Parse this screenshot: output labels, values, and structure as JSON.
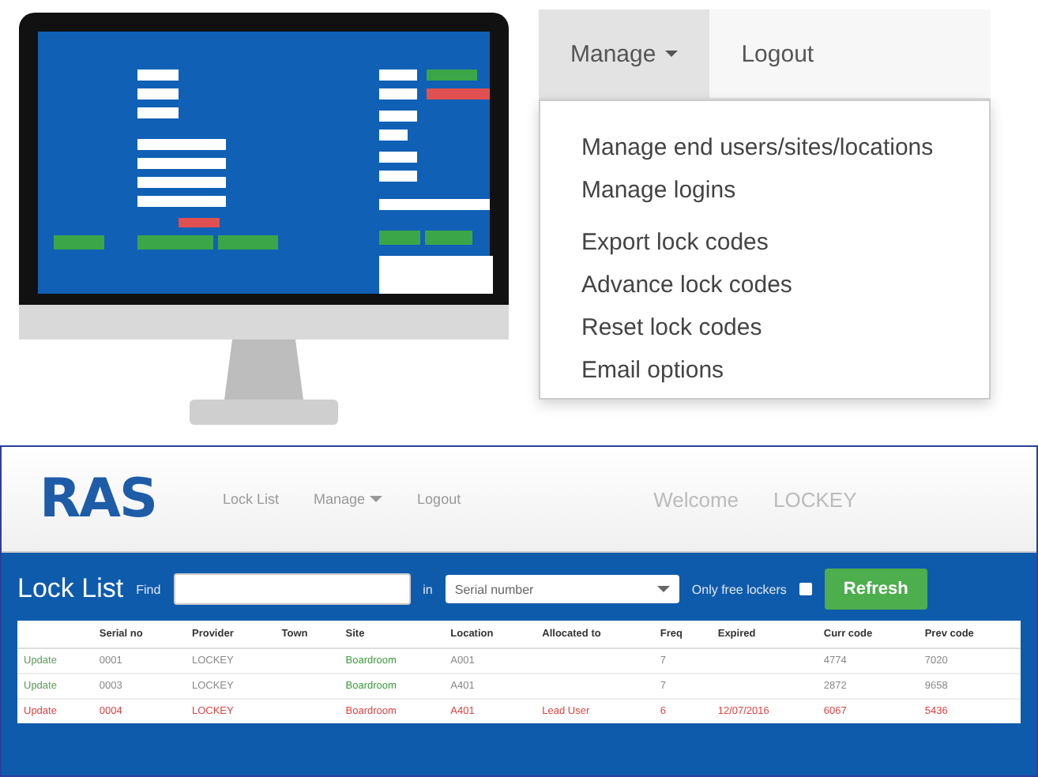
{
  "menu_screenshot": {
    "nav": [
      {
        "label": "Manage",
        "selected": true,
        "dropdown": true
      },
      {
        "label": "Logout",
        "selected": false,
        "dropdown": false
      }
    ],
    "menu_groups": [
      {
        "items": [
          "Manage end users/sites/locations",
          "Manage logins"
        ]
      },
      {
        "items": [
          "Export lock codes",
          "Advance lock codes",
          "Reset lock codes",
          "Email options"
        ]
      }
    ]
  },
  "app": {
    "logo": "RAS",
    "nav": [
      {
        "label": "Lock List",
        "dropdown": false
      },
      {
        "label": "Manage",
        "dropdown": true
      },
      {
        "label": "Logout",
        "dropdown": false
      }
    ],
    "welcome": "Welcome",
    "user": "LOCKEY",
    "toolbar": {
      "title": "Lock List",
      "find_label": "Find",
      "in_label": "in",
      "select_value": "Serial number",
      "free_label": "Only free lockers",
      "free_checked": false,
      "refresh": "Refresh"
    },
    "table": {
      "columns": [
        "Serial no",
        "Provider",
        "Town",
        "Site",
        "Location",
        "Allocated to",
        "Freq",
        "Expired",
        "Curr code",
        "Prev code"
      ],
      "rows": [
        {
          "expired": false,
          "action": "Update",
          "cells": [
            "0001",
            "LOCKEY",
            null,
            "Boardroom",
            "A001",
            null,
            "7",
            null,
            "4774",
            "7020"
          ]
        },
        {
          "expired": false,
          "action": "Update",
          "cells": [
            "0003",
            "LOCKEY",
            null,
            "Boardroom",
            "A401",
            null,
            "7",
            null,
            "2872",
            "9658"
          ]
        },
        {
          "expired": true,
          "action": "Update",
          "cells": [
            "0004",
            "LOCKEY",
            null,
            "Boardroom",
            "A401",
            "Lead User",
            "6",
            "12/07/2016",
            "6067",
            "5436"
          ]
        }
      ]
    }
  }
}
